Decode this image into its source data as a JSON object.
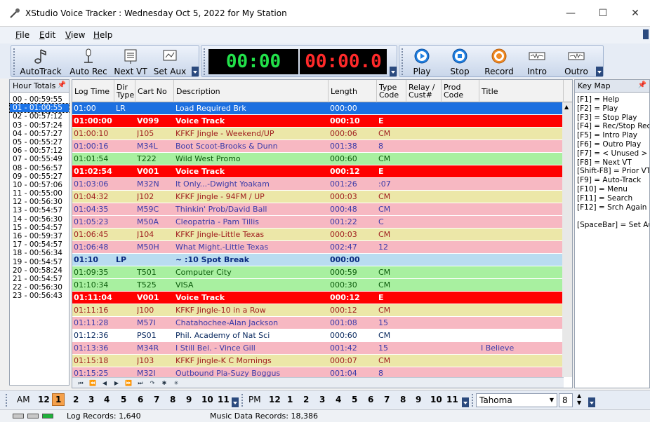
{
  "window": {
    "title": "XStudio Voice Tracker : Wednesday Oct 5, 2022 for My Station",
    "minimize": "—",
    "maximize": "☐",
    "close": "✕"
  },
  "menu": [
    {
      "label": "File",
      "key": "F",
      "rest": "ile"
    },
    {
      "label": "Edit",
      "key": "E",
      "rest": "dit"
    },
    {
      "label": "View",
      "key": "V",
      "rest": "iew"
    },
    {
      "label": "Help",
      "key": "H",
      "rest": "elp"
    }
  ],
  "toolbar": {
    "left_buttons": [
      {
        "label": "AutoTrack",
        "icon": "music-note-icon"
      },
      {
        "label": "Auto Rec",
        "icon": "mic-stand-icon"
      },
      {
        "label": "Next VT",
        "icon": "next-vt-icon"
      },
      {
        "label": "Set Aux",
        "icon": "set-aux-icon"
      }
    ],
    "timer_elapsed": "00:00",
    "timer_remaining": "00:00.0",
    "right_buttons": [
      {
        "label": "Play",
        "icon": "play-icon"
      },
      {
        "label": "Stop",
        "icon": "stop-icon"
      },
      {
        "label": "Record",
        "icon": "record-icon"
      },
      {
        "label": "Intro",
        "icon": "intro-icon"
      },
      {
        "label": "Outro",
        "icon": "outro-icon"
      }
    ]
  },
  "hour_totals": {
    "title": "Hour Totals",
    "selected_index": 1,
    "items": [
      "00 - 00:59:55",
      "01 - 01:00:55",
      "02 - 00:57:12",
      "03 - 00:57:24",
      "04 - 00:57:27",
      "05 - 00:55:27",
      "06 - 00:57:12",
      "07 - 00:55:49",
      "08 - 00:56:57",
      "09 - 00:55:27",
      "10 - 00:57:06",
      "11 - 00:55:00",
      "12 - 00:56:30",
      "13 - 00:54:57",
      "14 - 00:56:30",
      "15 - 00:54:57",
      "16 - 00:59:37",
      "17 - 00:54:57",
      "18 - 00:56:34",
      "19 - 00:54:57",
      "20 - 00:58:24",
      "21 - 00:54:57",
      "22 - 00:56:30",
      "23 - 00:56:43"
    ]
  },
  "log": {
    "columns": {
      "log_time": "Log Time",
      "dir_type": "Dir Type",
      "cart_no": "Cart No",
      "description": "Description",
      "length": "Length",
      "type_code": "Type Code",
      "relay": "Relay / Cust#",
      "prod_code": "Prod Code",
      "title": "Title"
    },
    "rows": [
      {
        "time": "01:00",
        "dir": "LR",
        "cart": "",
        "desc": "Load Required Brk",
        "len": "000:00",
        "type": "",
        "title": "",
        "style": "selected"
      },
      {
        "time": "01:00:00",
        "dir": "",
        "cart": "V099",
        "desc": "Voice Track",
        "len": "000:10",
        "type": "E",
        "title": "",
        "style": "vt"
      },
      {
        "time": "01:00:10",
        "dir": "",
        "cart": "J105",
        "desc": "KFKF Jingle - Weekend/UP",
        "len": "000:06",
        "type": "CM",
        "title": "",
        "style": "jingle"
      },
      {
        "time": "01:00:16",
        "dir": "",
        "cart": "M34L",
        "desc": "Boot Scoot-Brooks & Dunn",
        "len": "001:38",
        "type": "8",
        "title": "",
        "style": "music"
      },
      {
        "time": "01:01:54",
        "dir": "",
        "cart": "T222",
        "desc": "Wild West Promo",
        "len": "000:60",
        "type": "CM",
        "title": "",
        "style": "promo"
      },
      {
        "time": "01:02:54",
        "dir": "",
        "cart": "V001",
        "desc": "Voice Track",
        "len": "000:12",
        "type": "E",
        "title": "",
        "style": "vt"
      },
      {
        "time": "01:03:06",
        "dir": "",
        "cart": "M32N",
        "desc": "It Only...-Dwight Yoakam",
        "len": "001:26",
        "type": ":07",
        "title": "",
        "style": "music"
      },
      {
        "time": "01:04:32",
        "dir": "",
        "cart": "J102",
        "desc": "KFKF Jingle - 94FM / UP",
        "len": "000:03",
        "type": "CM",
        "title": "",
        "style": "jingle"
      },
      {
        "time": "01:04:35",
        "dir": "",
        "cart": "M59C",
        "desc": "Thinkin' Prob/David Ball",
        "len": "000:48",
        "type": "CM",
        "title": "",
        "style": "music"
      },
      {
        "time": "01:05:23",
        "dir": "",
        "cart": "M50A",
        "desc": "Cleopatria - Pam Tillis",
        "len": "001:22",
        "type": "C",
        "title": "",
        "style": "music"
      },
      {
        "time": "01:06:45",
        "dir": "",
        "cart": "J104",
        "desc": "KFKF Jingle-Little Texas",
        "len": "000:03",
        "type": "CM",
        "title": "",
        "style": "jingle"
      },
      {
        "time": "01:06:48",
        "dir": "",
        "cart": "M50H",
        "desc": "What Might.-Little Texas",
        "len": "002:47",
        "type": "12",
        "title": "",
        "style": "music"
      },
      {
        "time": "01:10",
        "dir": "LP",
        "cart": "",
        "desc": "~ :10 Spot Break",
        "len": "000:00",
        "type": "",
        "title": "",
        "style": "spot"
      },
      {
        "time": "01:09:35",
        "dir": "",
        "cart": "T501",
        "desc": "Computer City",
        "len": "000:59",
        "type": "CM",
        "title": "",
        "style": "promo"
      },
      {
        "time": "01:10:34",
        "dir": "",
        "cart": "T525",
        "desc": "VISA",
        "len": "000:30",
        "type": "CM",
        "title": "",
        "style": "promo"
      },
      {
        "time": "01:11:04",
        "dir": "",
        "cart": "V001",
        "desc": "Voice Track",
        "len": "000:12",
        "type": "E",
        "title": "",
        "style": "vt"
      },
      {
        "time": "01:11:16",
        "dir": "",
        "cart": "J100",
        "desc": "KFKF Jingle-10 in a Row",
        "len": "000:12",
        "type": "CM",
        "title": "",
        "style": "jingle"
      },
      {
        "time": "01:11:28",
        "dir": "",
        "cart": "M57I",
        "desc": "Chatahochee-Alan Jackson",
        "len": "001:08",
        "type": "15",
        "title": "",
        "style": "music"
      },
      {
        "time": "01:12:36",
        "dir": "",
        "cart": "PS01",
        "desc": "Phil. Academy of Nat Sci",
        "len": "000:60",
        "type": "CM",
        "title": "",
        "style": "plain"
      },
      {
        "time": "01:13:36",
        "dir": "",
        "cart": "M34R",
        "desc": "I Still Bel. - Vince Gill",
        "len": "001:42",
        "type": "15",
        "title": "I Believe",
        "style": "music"
      },
      {
        "time": "01:15:18",
        "dir": "",
        "cart": "J103",
        "desc": "KFKF Jingle-K C Mornings",
        "len": "000:07",
        "type": "CM",
        "title": "",
        "style": "jingle"
      },
      {
        "time": "01:15:25",
        "dir": "",
        "cart": "M32I",
        "desc": "Outbound Pla-Suzy Boggus",
        "len": "001:04",
        "type": "8",
        "title": "",
        "style": "music"
      }
    ],
    "nav_buttons": [
      "⏮",
      "⏪",
      "◀",
      "▶",
      "⏩",
      "⏭",
      "↷",
      "✱",
      "✳"
    ]
  },
  "keymap": {
    "title": "Key Map",
    "items": [
      "[F1] = Help",
      "[F2] = Play",
      "[F3] = Stop Play",
      "[F4] = Rec/Stop Rec",
      "[F5] = Intro Play",
      "[F6] = Outro Play",
      "[F7] = < Unused >",
      "[F8] = Next VT",
      "[Shift-F8] = Prior VT",
      "[F9] = Auto-Track",
      "[F10] = Menu",
      "[F11] = Search",
      "[F12] = Srch Again",
      "",
      "[SpaceBar] = Set Aux"
    ]
  },
  "hour_bar": {
    "am_label": "AM",
    "am_hours": [
      "12",
      "1",
      "2",
      "3",
      "4",
      "5",
      "6",
      "7",
      "8",
      "9",
      "10",
      "11"
    ],
    "am_active": "1",
    "pm_label": "PM",
    "pm_hours": [
      "12",
      "1",
      "2",
      "3",
      "4",
      "5",
      "6",
      "7",
      "8",
      "9",
      "10",
      "11"
    ],
    "font_name": "Tahoma",
    "font_size": "8"
  },
  "status": {
    "log_records": "Log Records: 1,640",
    "music_records": "Music Data Records: 18,386"
  },
  "colors": {
    "selected": "#1c6fe0",
    "vt": "#ff0000",
    "jingle": "#ece7a8",
    "music": "#f7b8c2",
    "promo": "#a8f0a0",
    "spot": "#b9dcf0",
    "plain": "#ffffff",
    "timer_green": "#22e24a",
    "timer_red": "#ff2a2a"
  }
}
